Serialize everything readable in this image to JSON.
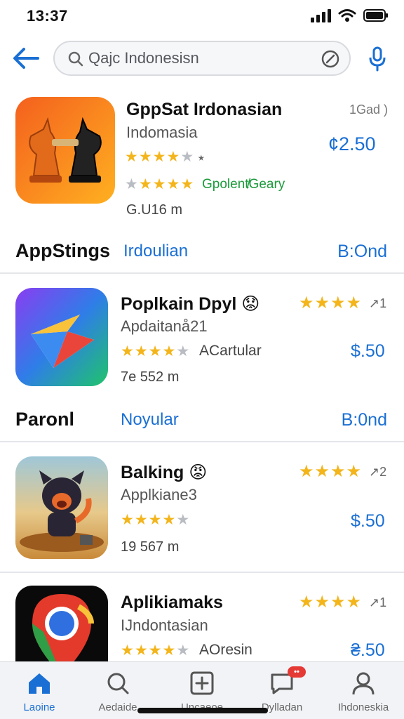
{
  "status": {
    "time": "13:37"
  },
  "search": {
    "query": "Qajc Indonesisn"
  },
  "featured": {
    "title": "GppSat Irdonasian",
    "subtitle": "Indomasia",
    "rating_note": "⭑",
    "rating_stars": 4,
    "ads_label": "Gpolent̸Geary",
    "size": "G.U16 m",
    "extra": "1Gad )",
    "price": "¢2.50"
  },
  "sections": [
    {
      "name": "AppStings",
      "mid": "Irdoulian",
      "right": "B:Ond"
    },
    {
      "name": "Paronl",
      "mid": "Noyular",
      "right": "B:0nd"
    }
  ],
  "apps": [
    {
      "title": "Poplkain Dpyl 😟",
      "subtitle": "Apdaitanå21",
      "rating_text": "ACartular",
      "size": "7e 552 m",
      "price": "$.50",
      "right_rating": "↗1",
      "stars": 4
    },
    {
      "title": "Balking 😡",
      "subtitle": "Applkiane3",
      "rating_text": "",
      "size": "19 567 m",
      "price": "$.50",
      "right_rating": "↗2",
      "stars": 4
    },
    {
      "title": "Aplikiamaks",
      "subtitle": "IJndontasian",
      "rating_text": "AOresin",
      "size": "",
      "price": "₴.50",
      "right_rating": "↗1",
      "stars": 4
    }
  ],
  "tabs": [
    {
      "label": "Laoine",
      "icon": "home-icon",
      "active": true
    },
    {
      "label": "Aedaide",
      "icon": "search-icon",
      "active": false
    },
    {
      "label": "Uncaeoe",
      "icon": "add-box-icon",
      "active": false
    },
    {
      "label": "Dylladan",
      "icon": "chat-icon",
      "active": false,
      "badge": "••"
    },
    {
      "label": "Ihdoneskia",
      "icon": "person-icon",
      "active": false
    }
  ],
  "colors": {
    "accent": "#1a6fd4",
    "star": "#f3b51b",
    "green": "#1b9a3b"
  }
}
